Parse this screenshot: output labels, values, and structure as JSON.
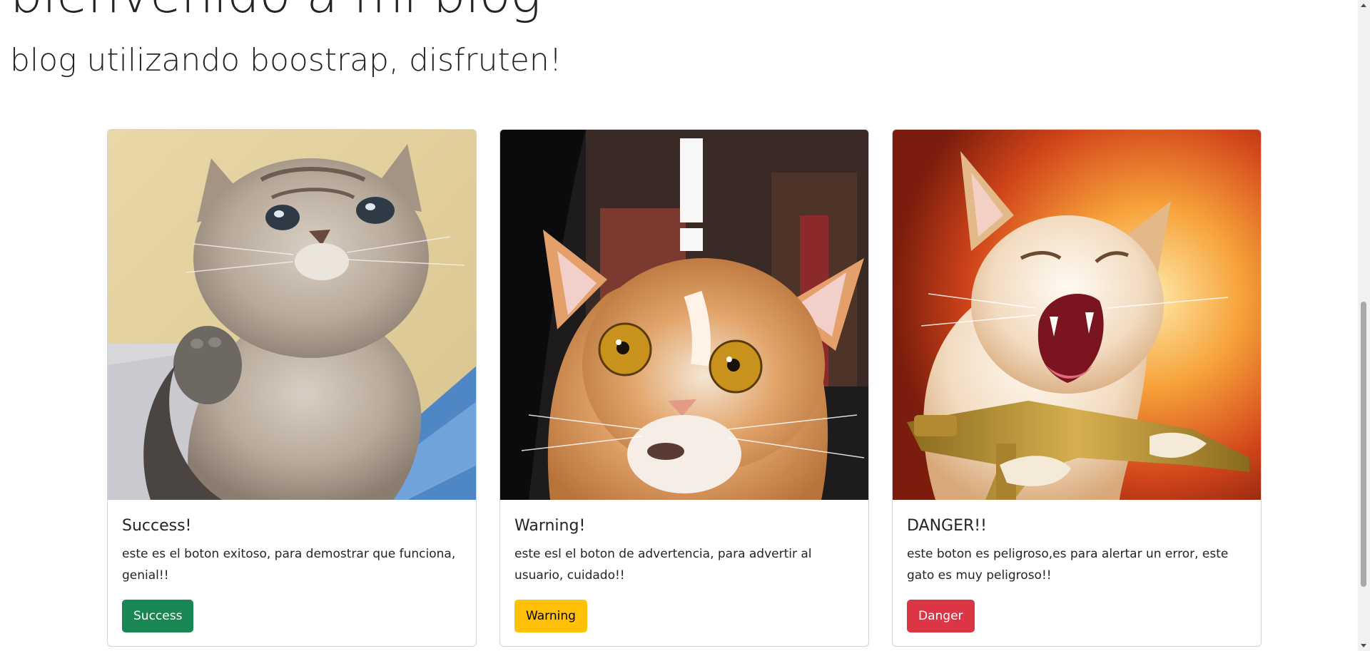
{
  "header": {
    "title": "bienvenido a mi blog",
    "subtitle": "blog utilizando boostrap, disfruten!"
  },
  "cards": [
    {
      "title": "Success!",
      "text": "este es el boton exitoso, para demostrar que funciona, genial!!",
      "button_label": "Success",
      "button_color": "#198754",
      "button_text_color": "#ffffff"
    },
    {
      "title": "Warning!",
      "text": "este esl el boton de advertencia, para advertir al usuario, cuidado!!",
      "button_label": "Warning",
      "button_color": "#ffc107",
      "button_text_color": "#000000"
    },
    {
      "title": "DANGER!!",
      "text": "este boton es peligroso,es para alertar un error, este gato es muy peligroso!!",
      "button_label": "Danger",
      "button_color": "#dc3545",
      "button_text_color": "#ffffff"
    }
  ],
  "scrollbar": {
    "position_fraction": 0.8
  }
}
